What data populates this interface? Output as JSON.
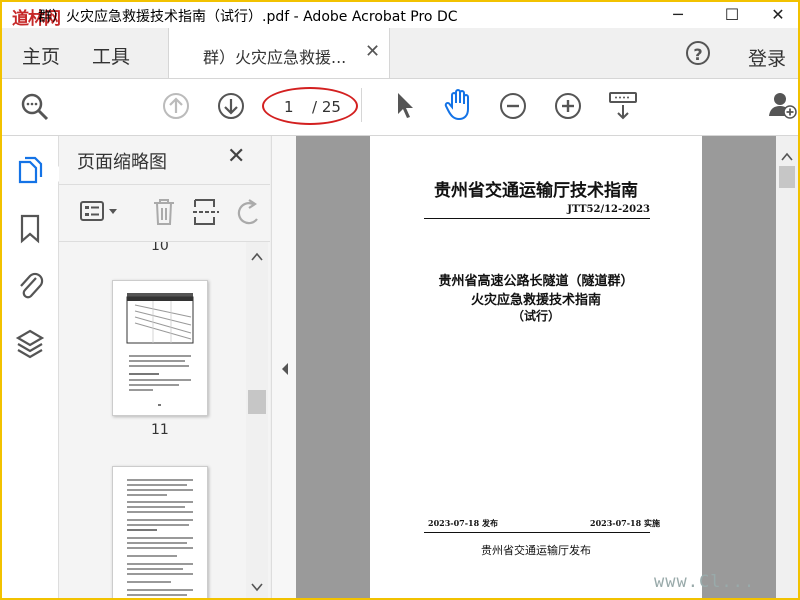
{
  "window": {
    "title": "群）火灾应急救援技术指南（试行）.pdf - Adobe Acrobat Pro DC",
    "watermark_logo": "道林网",
    "minimize_glyph": "─",
    "maximize_glyph": "☐",
    "close_glyph": "✕"
  },
  "menubar": {
    "home": "主页",
    "tools": "工具",
    "tab_label": "群）火灾应急救援...",
    "tab_close": "✕",
    "help": "?",
    "login": "登录"
  },
  "toolbar": {
    "current_page": "1",
    "total_pages": "/ 25",
    "icons": [
      "search-icon",
      "page-up-icon",
      "page-down-icon",
      "select-arrow-icon",
      "hand-tool-icon",
      "zoom-out-icon",
      "zoom-in-icon",
      "keyboard-scroll-icon",
      "add-user-icon"
    ],
    "accent": "#1473e6",
    "annotation_color": "#d32020"
  },
  "rail": {
    "icons": [
      "page-thumbnails-icon",
      "bookmark-icon",
      "attachment-icon",
      "layers-icon"
    ]
  },
  "panel": {
    "title": "页面缩略图",
    "close": "✕",
    "prev_label": "10",
    "thumb_label": "11"
  },
  "document": {
    "header_org": "贵州省交通运输厅技术指南",
    "code": "JTT52/12-2023",
    "title_line1": "贵州省高速公路长隧道（隧道群）",
    "title_line2": "火灾应急救援技术指南",
    "title_line3": "（试行）",
    "publish_date": "2023-07-18 发布",
    "effective_date": "2023-07-18 实施",
    "issuer": "贵州省交通运输厅发布"
  },
  "watermark_url": "www.Cl..."
}
